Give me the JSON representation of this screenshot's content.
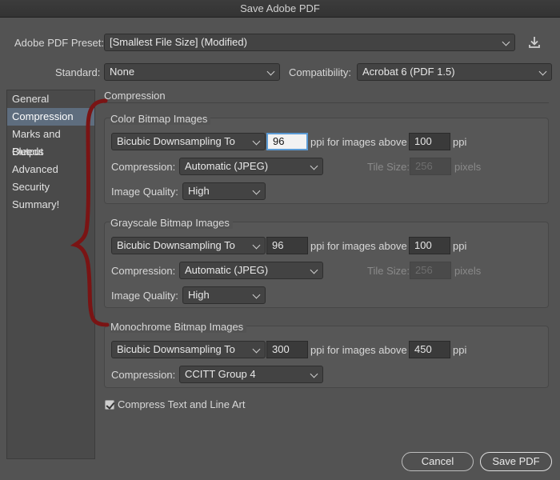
{
  "window": {
    "title": "Save Adobe PDF"
  },
  "preset": {
    "label": "Adobe PDF Preset:",
    "value": "[Smallest File Size] (Modified)"
  },
  "standard": {
    "label": "Standard:",
    "value": "None"
  },
  "compatibility": {
    "label": "Compatibility:",
    "value": "Acrobat 6 (PDF 1.5)"
  },
  "sidebar": {
    "items": [
      {
        "label": "General"
      },
      {
        "label": "Compression"
      },
      {
        "label": "Marks and Bleeds"
      },
      {
        "label": "Output"
      },
      {
        "label": "Advanced"
      },
      {
        "label": "Security"
      },
      {
        "label": "Summary!"
      }
    ],
    "active": "Compression"
  },
  "panel": {
    "title": "Compression"
  },
  "color": {
    "title": "Color Bitmap Images",
    "downsampling": "Bicubic Downsampling To",
    "ppi": "96",
    "ppi_above_label": "ppi for images above",
    "above": "100",
    "ppi_label": "ppi",
    "compression_label": "Compression:",
    "compression": "Automatic (JPEG)",
    "tile_label": "Tile Size:",
    "tile": "256",
    "pixels_label": "pixels",
    "quality_label": "Image Quality:",
    "quality": "High"
  },
  "gray": {
    "title": "Grayscale Bitmap Images",
    "downsampling": "Bicubic Downsampling To",
    "ppi": "96",
    "ppi_above_label": "ppi for images above",
    "above": "100",
    "ppi_label": "ppi",
    "compression_label": "Compression:",
    "compression": "Automatic (JPEG)",
    "tile_label": "Tile Size:",
    "tile": "256",
    "pixels_label": "pixels",
    "quality_label": "Image Quality:",
    "quality": "High"
  },
  "mono": {
    "title": "Monochrome Bitmap Images",
    "downsampling": "Bicubic Downsampling To",
    "ppi": "300",
    "ppi_above_label": "ppi for images above",
    "above": "450",
    "ppi_label": "ppi",
    "compression_label": "Compression:",
    "compression": "CCITT Group 4"
  },
  "compress_text": {
    "label": "Compress Text and Line Art",
    "checked": true
  },
  "buttons": {
    "cancel": "Cancel",
    "save": "Save PDF"
  },
  "icons": {
    "save_preset": "download-icon"
  },
  "colors": {
    "annotation_brace": "#7a1414",
    "selection": "#5e6d7e",
    "focus_ring": "#5b9bd5"
  }
}
